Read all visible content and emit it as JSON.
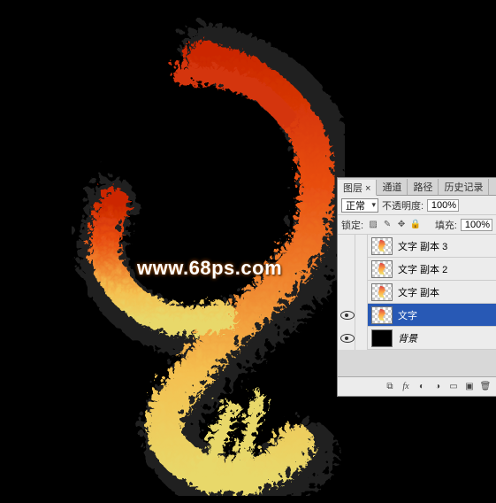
{
  "watermark": "www.68ps.com",
  "panel": {
    "tabs": {
      "layers": "图层 ×",
      "channels": "通道",
      "paths": "路径",
      "history": "历史记录"
    },
    "blend_mode": "正常",
    "opacity_label": "不透明度:",
    "opacity_value": "100%",
    "lock_label": "锁定:",
    "fill_label": "填充:",
    "fill_value": "100%"
  },
  "layers": [
    {
      "name": "文字 副本 3",
      "visible": false,
      "selected": false,
      "thumb": "trans"
    },
    {
      "name": "文字 副本 2",
      "visible": false,
      "selected": false,
      "thumb": "trans"
    },
    {
      "name": "文字 副本",
      "visible": false,
      "selected": false,
      "thumb": "trans"
    },
    {
      "name": "文字",
      "visible": true,
      "selected": true,
      "thumb": "trans"
    },
    {
      "name": "背景",
      "visible": true,
      "selected": false,
      "thumb": "black",
      "italic": true
    }
  ],
  "footer_icons": {
    "link": "link-icon",
    "fx": "fx-icon",
    "mask": "mask-icon",
    "adjust": "adjust-icon",
    "group": "group-icon",
    "new": "new-layer-icon",
    "trash": "trash-icon"
  }
}
